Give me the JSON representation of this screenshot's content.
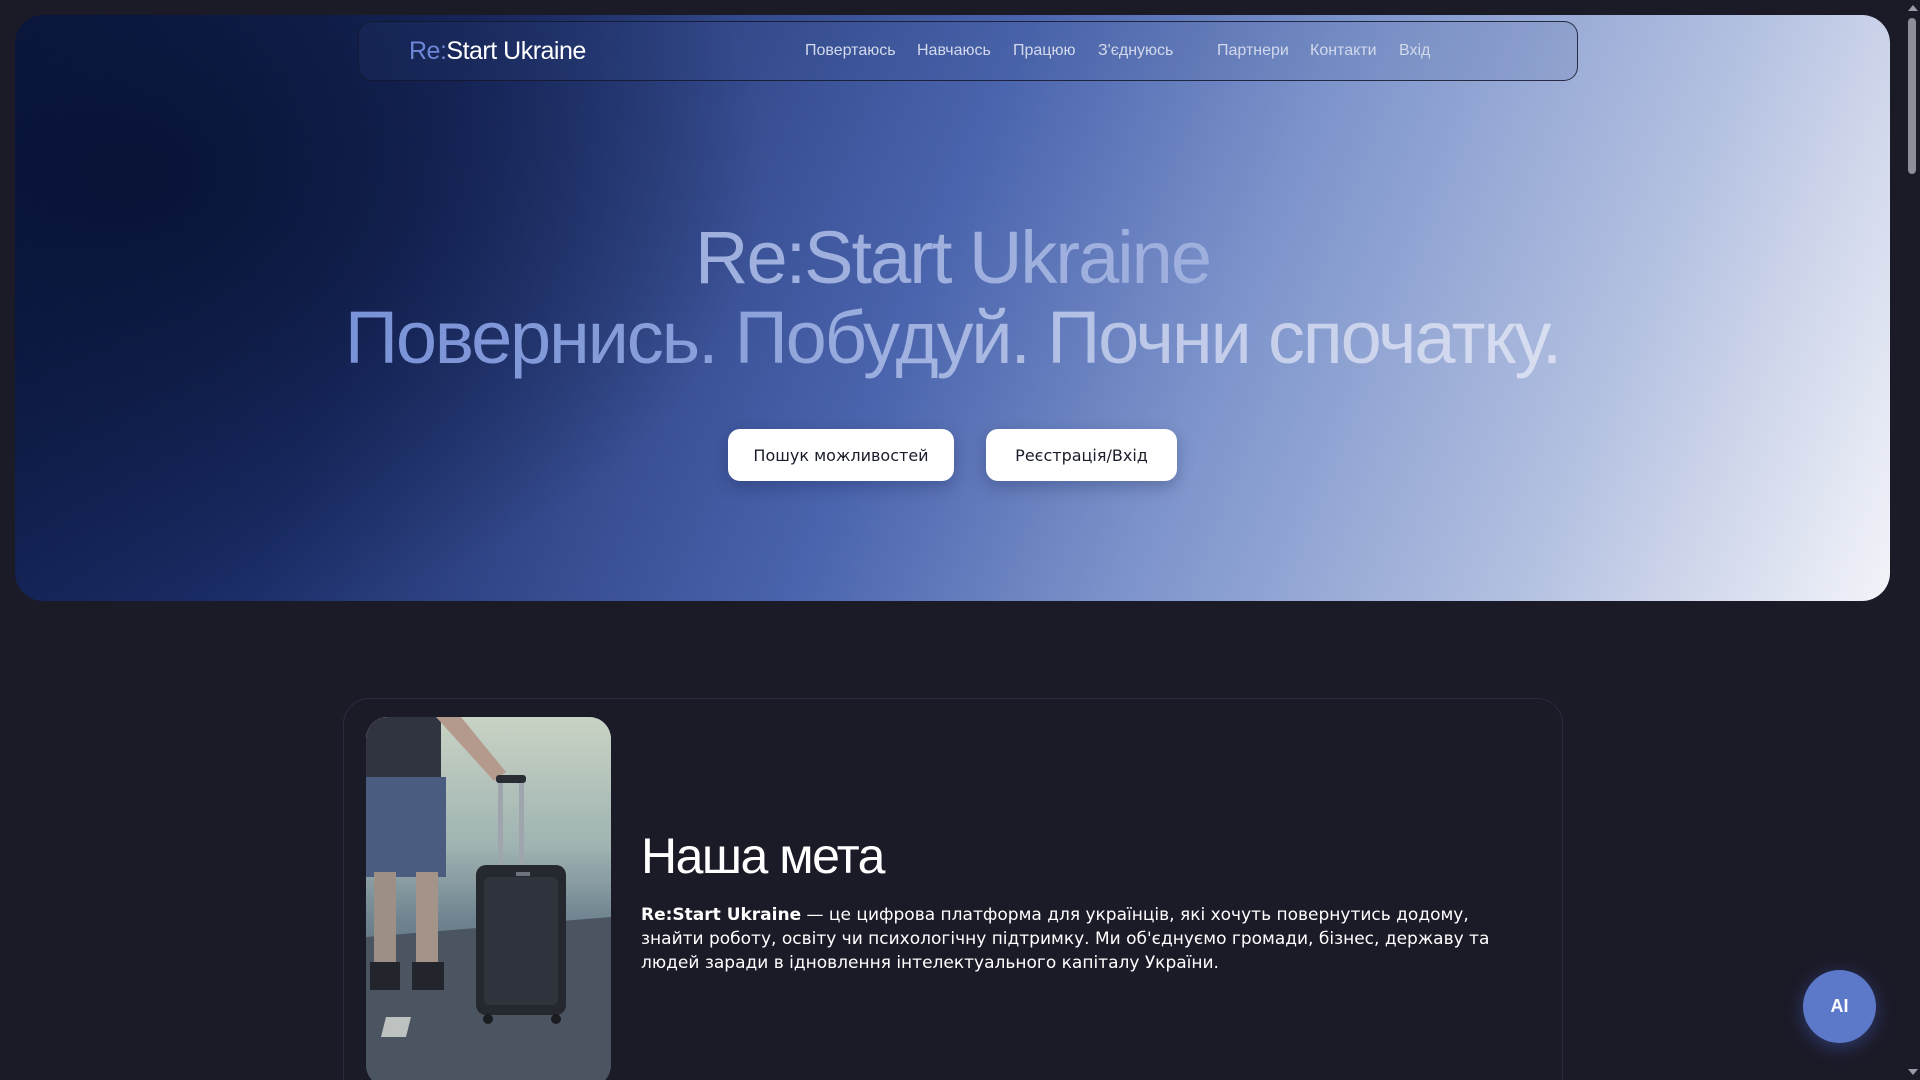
{
  "brand": {
    "logo_prefix": "Re:",
    "logo_name": "Start Ukraine"
  },
  "nav": {
    "items": [
      {
        "label": "Повертаюсь"
      },
      {
        "label": "Навчаюсь"
      },
      {
        "label": "Працюю"
      },
      {
        "label": "З'єднуюсь"
      },
      {
        "label": "Партнери"
      },
      {
        "label": "Контакти"
      },
      {
        "label": "Вхід"
      }
    ]
  },
  "hero": {
    "title": "Re:Start Ukraine",
    "subtitle": "Повернись. Побудуй. Почни спочатку.",
    "buttons": {
      "search_label": "Пошук можливостей",
      "register_label": "Реєстрація/Вхід"
    }
  },
  "goal": {
    "heading": "Наша мета",
    "brand_bold": "Re:Start Ukraine",
    "text": " — це цифрова платформа для українців, які хочуть повернутись додому, знайти роботу, освіту чи психологічну підтримку. Ми об'єднуємо громади, бізнес, державу та людей заради в ідновлення інтелектуального капіталу України."
  },
  "ai_button": {
    "label": "AI"
  },
  "colors": {
    "page_bg": "#1b1a27",
    "accent": "#6d86d6",
    "ai_button": "#5b78c9"
  }
}
